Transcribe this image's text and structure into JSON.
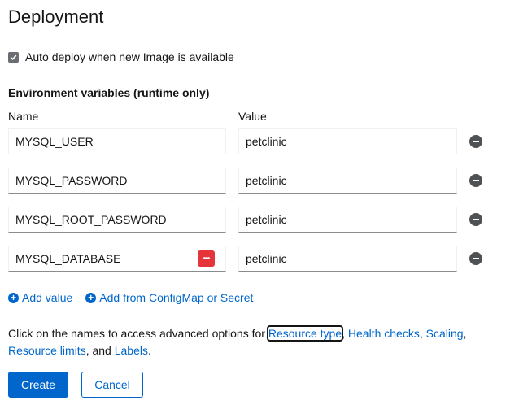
{
  "title": "Deployment",
  "auto_deploy": {
    "label": "Auto deploy when new Image is available",
    "checked": true
  },
  "env": {
    "section_title": "Environment variables (runtime only)",
    "name_header": "Name",
    "value_header": "Value",
    "rows": [
      {
        "name": "MYSQL_USER",
        "value": "petclinic"
      },
      {
        "name": "MYSQL_PASSWORD",
        "value": "petclinic"
      },
      {
        "name": "MYSQL_ROOT_PASSWORD",
        "value": "petclinic"
      },
      {
        "name": "MYSQL_DATABASE",
        "value": "petclinic"
      }
    ],
    "add_value": "Add value",
    "add_from": "Add from ConfigMap or Secret"
  },
  "help": {
    "prefix": "Click on the names to access advanced options for ",
    "link_resource_type": "Resource type",
    "sep1": ", ",
    "link_health_checks": "Health checks",
    "sep2": ", ",
    "link_scaling": "Scaling",
    "sep3": ",",
    "link_resource_limits": "Resource limits",
    "sep4": ", and ",
    "link_labels": "Labels",
    "suffix": "."
  },
  "actions": {
    "create": "Create",
    "cancel": "Cancel"
  },
  "colors": {
    "link": "#0066cc",
    "primary": "#0066cc",
    "password_badge": "#e5353b"
  },
  "icons": {
    "checkbox": "checkmark-icon",
    "remove": "minus-circle-icon",
    "add": "plus-circle-icon",
    "password_manager": "password-dots-icon"
  }
}
